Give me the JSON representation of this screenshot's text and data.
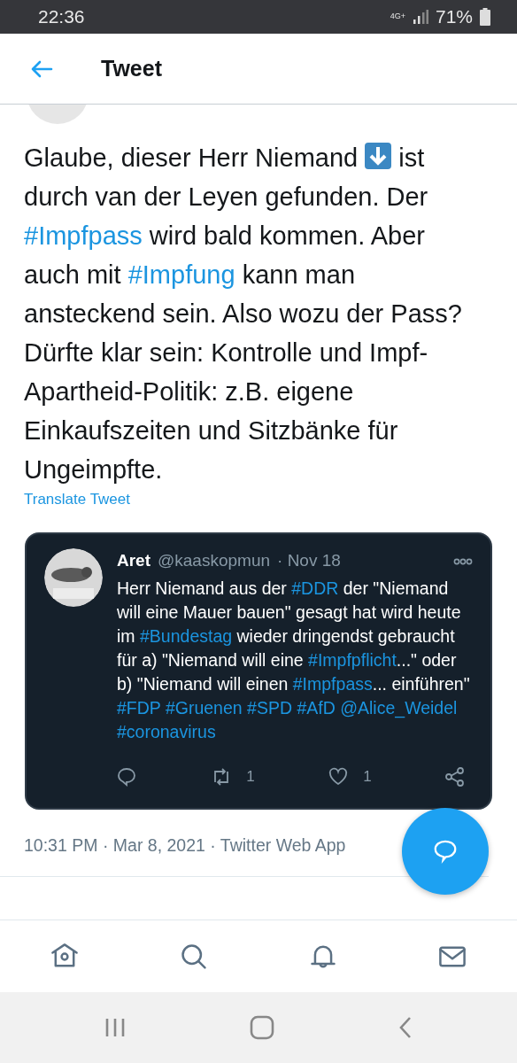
{
  "status_bar": {
    "time": "22:36",
    "network": "4G+",
    "battery": "71%"
  },
  "header": {
    "title": "Tweet"
  },
  "tweet": {
    "segments": [
      {
        "kind": "text",
        "text": "Glaube, dieser Herr Niemand "
      },
      {
        "kind": "icon"
      },
      {
        "kind": "text",
        "text": " ist durch van der Leyen gefunden. Der "
      },
      {
        "kind": "hashtag",
        "text": "#Impfpass"
      },
      {
        "kind": "text",
        "text": " wird bald kommen. Aber auch mit "
      },
      {
        "kind": "hashtag",
        "text": "#Impfung"
      },
      {
        "kind": "text",
        "text": " kann man ansteckend sein. Also wozu der Pass? Dürfte klar sein: Kontrolle und Impf-Apartheid-Politik: z.B. eigene Einkaufszeiten und Sitzbänke für Ungeimpfte."
      }
    ],
    "translate": "Translate Tweet",
    "quoted": {
      "name": "Aret",
      "handle": "@kaaskopmun",
      "date": "· Nov 18",
      "segments": [
        {
          "kind": "text",
          "text": "Herr Niemand aus der "
        },
        {
          "kind": "hashtag",
          "text": "#DDR"
        },
        {
          "kind": "text",
          "text": " der \"Niemand will eine Mauer bauen\" gesagt hat wird heute im "
        },
        {
          "kind": "hashtag",
          "text": "#Bundestag"
        },
        {
          "kind": "text",
          "text": " wieder dringendst gebraucht für a) \"Niemand will eine "
        },
        {
          "kind": "hashtag",
          "text": "#Impfpflicht"
        },
        {
          "kind": "text",
          "text": "...\" oder b) \"Niemand will einen "
        },
        {
          "kind": "hashtag",
          "text": "#Impfpass"
        },
        {
          "kind": "text",
          "text": "... einführen\" "
        },
        {
          "kind": "hashtag",
          "text": "#FDP"
        },
        {
          "kind": "hashtag",
          "text": "#Gruenen"
        },
        {
          "kind": "hashtag",
          "text": "#SPD"
        },
        {
          "kind": "hashtag",
          "text": "#AfD"
        },
        {
          "kind": "hashtag",
          "text": "@Alice_Weidel"
        },
        {
          "kind": "hashtag",
          "text": "#coronavirus"
        }
      ],
      "actions": [
        {
          "kind": "reply"
        },
        {
          "kind": "retweet",
          "count": "1"
        },
        {
          "kind": "like",
          "count": "1"
        },
        {
          "kind": "share"
        }
      ]
    },
    "meta": "10:31 PM · Mar 8, 2021 · Twitter Web App"
  },
  "bottom_nav": [
    {
      "kind": "home"
    },
    {
      "kind": "search"
    },
    {
      "kind": "notifications"
    },
    {
      "kind": "messages"
    }
  ]
}
